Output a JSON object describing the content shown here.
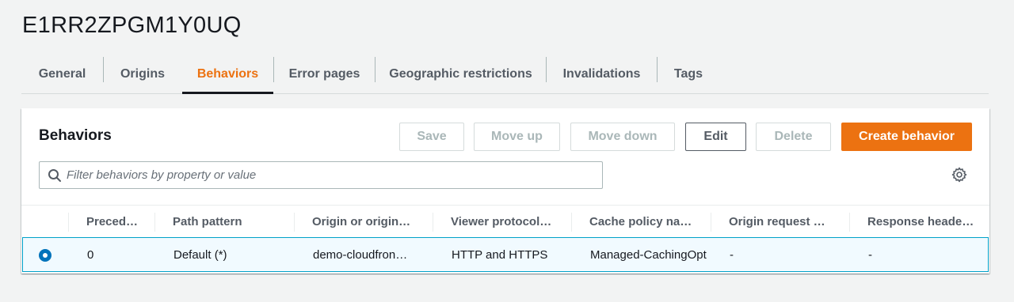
{
  "page": {
    "title": "E1RR2ZPGM1Y0UQ"
  },
  "tabs": [
    {
      "label": "General"
    },
    {
      "label": "Origins"
    },
    {
      "label": "Behaviors"
    },
    {
      "label": "Error pages"
    },
    {
      "label": "Geographic restrictions"
    },
    {
      "label": "Invalidations"
    },
    {
      "label": "Tags"
    }
  ],
  "active_tab": "Behaviors",
  "behaviors": {
    "title": "Behaviors",
    "buttons": {
      "save": "Save",
      "move_up": "Move up",
      "move_down": "Move down",
      "edit": "Edit",
      "delete": "Delete",
      "create": "Create behavior"
    },
    "filter": {
      "placeholder": "Filter behaviors by property or value",
      "value": ""
    },
    "columns": [
      "Preced…",
      "Path pattern",
      "Origin or origin…",
      "Viewer protocol…",
      "Cache policy na…",
      "Origin request …",
      "Response heade…"
    ],
    "rows": [
      {
        "selected": true,
        "precedence": "0",
        "path_pattern": "Default (*)",
        "origin": "demo-cloudfron…",
        "viewer_protocol": "HTTP and HTTPS",
        "cache_policy": "Managed-CachingOpt",
        "origin_request": "-",
        "response_headers": "-"
      }
    ]
  },
  "colors": {
    "accent": "#ec7211",
    "selected_border": "#00a1c9",
    "selected_bg": "#f1faff",
    "radio": "#0073bb"
  },
  "icons": [
    "search-icon",
    "gear-icon"
  ]
}
